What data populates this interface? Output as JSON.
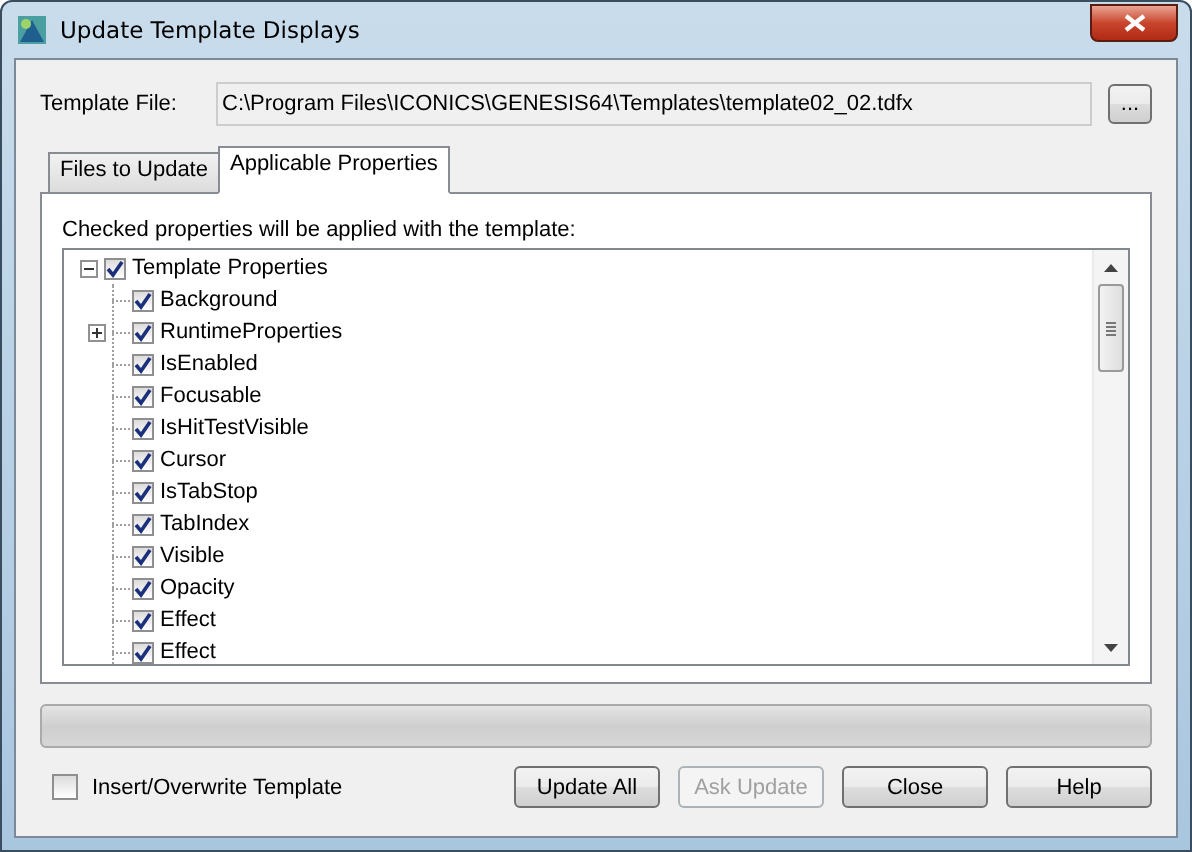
{
  "window": {
    "title": "Update Template Displays"
  },
  "template_file": {
    "label": "Template File:",
    "value": "C:\\Program Files\\ICONICS\\GENESIS64\\Templates\\template02_02.tdfx",
    "browse": "..."
  },
  "tabs": [
    {
      "label": "Files to Update",
      "selected": false
    },
    {
      "label": "Applicable Properties",
      "selected": true
    }
  ],
  "instruction": "Checked properties will be applied with the template:",
  "tree": [
    {
      "label": "Template Properties",
      "checked": true,
      "expanded": true,
      "children": [
        {
          "label": "Background",
          "checked": true
        },
        {
          "label": "RuntimeProperties",
          "checked": true,
          "expanded": false
        },
        {
          "label": "IsEnabled",
          "checked": true
        },
        {
          "label": "Focusable",
          "checked": true
        },
        {
          "label": "IsHitTestVisible",
          "checked": true
        },
        {
          "label": "Cursor",
          "checked": true
        },
        {
          "label": "IsTabStop",
          "checked": true
        },
        {
          "label": "TabIndex",
          "checked": true
        },
        {
          "label": "Visible",
          "checked": true
        },
        {
          "label": "Opacity",
          "checked": true
        },
        {
          "label": "Effect",
          "checked": true
        },
        {
          "label": "Effect",
          "checked": true
        }
      ]
    }
  ],
  "progress": {
    "level": 0
  },
  "insert_overwrite": {
    "label": "Insert/Overwrite Template",
    "checked": false
  },
  "buttons": [
    {
      "label": "Update All",
      "disabled": false
    },
    {
      "label": "Ask Update",
      "disabled": true
    },
    {
      "label": "Close",
      "disabled": false
    },
    {
      "label": "Help",
      "disabled": false
    }
  ]
}
